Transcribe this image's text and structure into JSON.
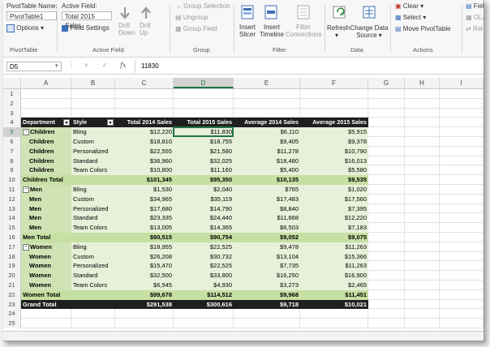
{
  "ribbon": {
    "pivottable_name_label": "PivotTable Name:",
    "pivottable_name_value": "PivotTable1",
    "options_label": "Options",
    "pivottable_group": "PivotTable",
    "active_field_label": "Active Field:",
    "active_field_value": "Total 2015 Sales",
    "field_settings_label": "Field Settings",
    "drill_down_label": "Drill Down",
    "drill_up_label": "Drill Up",
    "active_field_group": "Active Field",
    "group_selection_label": "Group Selection",
    "ungroup_label": "Ungroup",
    "group_field_label": "Group Field",
    "group_group": "Group",
    "insert_slicer_label": "Insert Slicer",
    "insert_timeline_label": "Insert Timeline",
    "filter_connections_label": "Filter Connections",
    "filter_group": "Filter",
    "refresh_label": "Refresh",
    "change_data_source_label": "Change Data Source",
    "data_group": "Data",
    "clear_label": "Clear",
    "select_label": "Select",
    "move_pivottable_label": "Move PivotTable",
    "actions_group": "Actions",
    "fields_partial": "Field",
    "olap_partial": "OLA",
    "relationships_partial": "Rel"
  },
  "formula_bar": {
    "name_box": "D5",
    "cancel": "×",
    "enter": "✓",
    "fx": "fx",
    "value": "11830"
  },
  "columns": [
    "A",
    "B",
    "C",
    "D",
    "E",
    "F",
    "G",
    "H",
    "I"
  ],
  "rows": [
    "1",
    "2",
    "3",
    "4",
    "5",
    "6",
    "7",
    "8",
    "9",
    "10",
    "11",
    "12",
    "13",
    "14",
    "15",
    "16",
    "17",
    "18",
    "19",
    "20",
    "21",
    "22",
    "23",
    "24",
    "25"
  ],
  "pivot": {
    "headers": [
      "Department",
      "Style",
      "Total 2014 Sales",
      "Total 2015 Sales",
      "Average 2014 Sales",
      "Average 2015 Sales"
    ],
    "data_rows": [
      {
        "dept": "Children",
        "style": "Bling",
        "c": "$12,220",
        "d": "$11,830",
        "e": "$6,110",
        "f": "$5,915",
        "type": "item",
        "first": true
      },
      {
        "dept": "Children",
        "style": "Custom",
        "c": "$18,810",
        "d": "$18,755",
        "e": "$9,405",
        "f": "$9,378",
        "type": "item"
      },
      {
        "dept": "Children",
        "style": "Personalized",
        "c": "$22,555",
        "d": "$21,580",
        "e": "$11,278",
        "f": "$10,790",
        "type": "item"
      },
      {
        "dept": "Children",
        "style": "Standard",
        "c": "$36,960",
        "d": "$32,025",
        "e": "$18,480",
        "f": "$16,013",
        "type": "item"
      },
      {
        "dept": "Children",
        "style": "Team Colors",
        "c": "$10,800",
        "d": "$11,160",
        "e": "$5,400",
        "f": "$5,580",
        "type": "item"
      },
      {
        "dept": "Children Total",
        "style": "",
        "c": "$101,345",
        "d": "$95,350",
        "e": "$10,135",
        "f": "$9,535",
        "type": "subtotal"
      },
      {
        "dept": "Men",
        "style": "Bling",
        "c": "$1,530",
        "d": "$2,040",
        "e": "$765",
        "f": "$1,020",
        "type": "item",
        "first": true
      },
      {
        "dept": "Men",
        "style": "Custom",
        "c": "$34,965",
        "d": "$35,119",
        "e": "$17,483",
        "f": "$17,560",
        "type": "item"
      },
      {
        "dept": "Men",
        "style": "Personalized",
        "c": "$17,680",
        "d": "$14,790",
        "e": "$8,840",
        "f": "$7,395",
        "type": "item"
      },
      {
        "dept": "Men",
        "style": "Standard",
        "c": "$23,335",
        "d": "$24,440",
        "e": "$11,668",
        "f": "$12,220",
        "type": "item"
      },
      {
        "dept": "Men",
        "style": "Team Colors",
        "c": "$13,005",
        "d": "$14,365",
        "e": "$6,503",
        "f": "$7,183",
        "type": "item"
      },
      {
        "dept": "Men Total",
        "style": "",
        "c": "$90,515",
        "d": "$90,754",
        "e": "$9,052",
        "f": "$9,075",
        "type": "subtotal"
      },
      {
        "dept": "Women",
        "style": "Bling",
        "c": "$18,955",
        "d": "$22,525",
        "e": "$9,478",
        "f": "$11,263",
        "type": "item",
        "first": true
      },
      {
        "dept": "Women",
        "style": "Custom",
        "c": "$26,208",
        "d": "$30,732",
        "e": "$13,104",
        "f": "$15,366",
        "type": "item"
      },
      {
        "dept": "Women",
        "style": "Personalized",
        "c": "$15,470",
        "d": "$22,525",
        "e": "$7,735",
        "f": "$11,263",
        "type": "item"
      },
      {
        "dept": "Women",
        "style": "Standard",
        "c": "$32,500",
        "d": "$33,800",
        "e": "$16,250",
        "f": "$16,900",
        "type": "item"
      },
      {
        "dept": "Women",
        "style": "Team Colors",
        "c": "$6,545",
        "d": "$4,930",
        "e": "$3,273",
        "f": "$2,465",
        "type": "item"
      },
      {
        "dept": "Women Total",
        "style": "",
        "c": "$99,678",
        "d": "$114,512",
        "e": "$9,968",
        "f": "$11,451",
        "type": "subtotal"
      },
      {
        "dept": "Grand Total",
        "style": "",
        "c": "$291,538",
        "d": "$300,616",
        "e": "$9,718",
        "f": "$10,021",
        "type": "grand"
      }
    ]
  },
  "selected_cell": "D5",
  "colors": {
    "accent": "#217346",
    "pivot_header": "#1f1f1f",
    "pivot_subtotal": "#c6e0a3",
    "pivot_body": "#e7f0d8"
  }
}
